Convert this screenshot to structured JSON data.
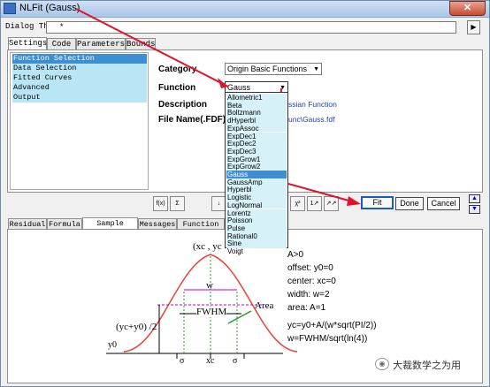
{
  "window": {
    "title": "NLFit (Gauss)",
    "close_label": "✕"
  },
  "dialog_theme": {
    "label": "Dialog Theme",
    "value": "*",
    "menu_btn": "▶"
  },
  "top_tabs": [
    {
      "label": "Settings"
    },
    {
      "label": "Code"
    },
    {
      "label": "Parameters"
    },
    {
      "label": "Bounds"
    }
  ],
  "tree": [
    {
      "label": "Function Selection"
    },
    {
      "label": "Data Selection"
    },
    {
      "label": "Fitted Curves"
    },
    {
      "label": "Advanced"
    },
    {
      "label": "Output"
    }
  ],
  "fields": {
    "category_label": "Category",
    "category_value": "Origin Basic Functions",
    "function_label": "Function",
    "function_value": "Gauss",
    "description_label": "Description",
    "description_value": "ssian Function",
    "file_label": "File Name(.FDF)",
    "file_value": "unc\\Gauss.fdf"
  },
  "function_list": [
    {
      "label": "Allometric1"
    },
    {
      "label": "Beta"
    },
    {
      "label": "Boltzmann"
    },
    {
      "label": "dHyperbl"
    },
    {
      "label": "ExpAssoc"
    },
    {
      "label": "ExpDec1"
    },
    {
      "label": "ExpDec2"
    },
    {
      "label": "ExpDec3"
    },
    {
      "label": "ExpGrow1"
    },
    {
      "label": "ExpGrow2"
    },
    {
      "label": "Gauss"
    },
    {
      "label": "GaussAmp"
    },
    {
      "label": "Hyperbl"
    },
    {
      "label": "Logistic"
    },
    {
      "label": "LogNormal"
    },
    {
      "label": "Lorentz"
    },
    {
      "label": "Poisson"
    },
    {
      "label": "Pulse"
    },
    {
      "label": "Rational0"
    },
    {
      "label": "Sine"
    },
    {
      "label": "Voigt"
    }
  ],
  "toolbar": {
    "b1": "f(x)",
    "b2": "Σ",
    "b3": "↓",
    "b4": "χ²",
    "b5": "1↗",
    "b6": "↗↗"
  },
  "actions": {
    "fit": "Fit",
    "done": "Done",
    "cancel": "Cancel",
    "up": "▲",
    "down": "▼"
  },
  "bottom_tabs": [
    {
      "label": "Residual"
    },
    {
      "label": "Formula"
    },
    {
      "label": "Sample Curve"
    },
    {
      "label": "Messages"
    },
    {
      "label": "Function Fil"
    }
  ],
  "sample": {
    "peak_label": "(xc , yc",
    "w_label": "w",
    "fwhm_label": "FWHM",
    "area_label": "Area",
    "half_label": "(yc+y0) /2",
    "y0_label": "y0",
    "sigma_left": "σ",
    "xc_label": "xc",
    "sigma_right": "σ",
    "params": [
      "A>0",
      "offset: y0=0",
      "center: xc=0",
      "width: w=2",
      "area: A=1"
    ],
    "formula1": "yc=y0+A/(w*sqrt(PI/2))",
    "formula2": "w=FWHM/sqrt(ln(4))"
  },
  "watermark": "大裁数学之为用",
  "colors": {
    "curve": "#e8413a",
    "guide": "#c000c0",
    "arrow": "#e0132c",
    "selection": "#3d8ed3"
  }
}
